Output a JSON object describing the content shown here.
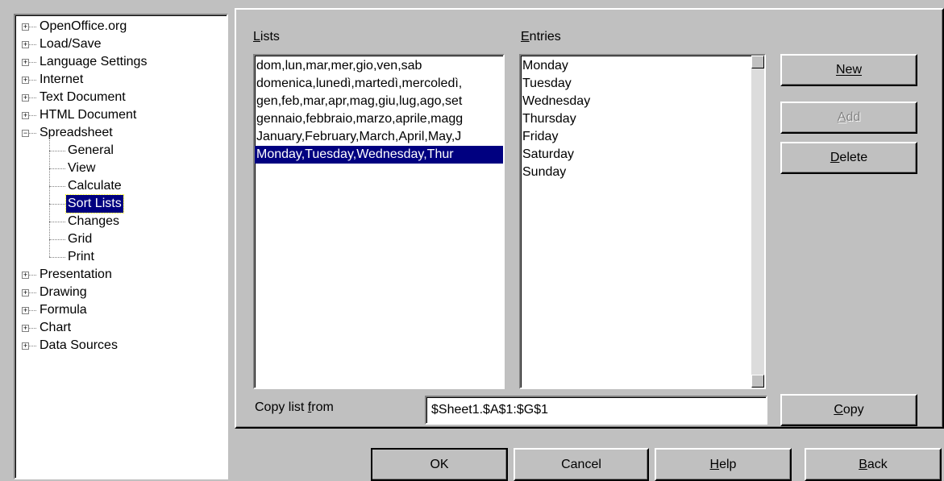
{
  "tree": {
    "items": [
      {
        "label": "OpenOffice.org",
        "level": 0,
        "expander": "+"
      },
      {
        "label": "Load/Save",
        "level": 0,
        "expander": "+"
      },
      {
        "label": "Language Settings",
        "level": 0,
        "expander": "+"
      },
      {
        "label": "Internet",
        "level": 0,
        "expander": "+"
      },
      {
        "label": "Text Document",
        "level": 0,
        "expander": "+"
      },
      {
        "label": "HTML Document",
        "level": 0,
        "expander": "+"
      },
      {
        "label": "Spreadsheet",
        "level": 0,
        "expander": "−"
      },
      {
        "label": "General",
        "level": 1
      },
      {
        "label": "View",
        "level": 1
      },
      {
        "label": "Calculate",
        "level": 1
      },
      {
        "label": "Sort Lists",
        "level": 1,
        "selected": true
      },
      {
        "label": "Changes",
        "level": 1
      },
      {
        "label": "Grid",
        "level": 1
      },
      {
        "label": "Print",
        "level": 1
      },
      {
        "label": "Presentation",
        "level": 0,
        "expander": "+"
      },
      {
        "label": "Drawing",
        "level": 0,
        "expander": "+"
      },
      {
        "label": "Formula",
        "level": 0,
        "expander": "+"
      },
      {
        "label": "Chart",
        "level": 0,
        "expander": "+"
      },
      {
        "label": "Data Sources",
        "level": 0,
        "expander": "+"
      }
    ]
  },
  "lists": {
    "label": "Lists",
    "items": [
      "dom,lun,mar,mer,gio,ven,sab",
      "domenica,lunedì,martedì,mercoledì,",
      "gen,feb,mar,apr,mag,giu,lug,ago,set",
      "gennaio,febbraio,marzo,aprile,magg",
      "January,February,March,April,May,J",
      "Monday,Tuesday,Wednesday,Thur"
    ],
    "selected_index": 5
  },
  "entries": {
    "label": "Entries",
    "items": [
      "Monday",
      "Tuesday",
      "Wednesday",
      "Thursday",
      "Friday",
      "Saturday",
      "Sunday"
    ]
  },
  "buttons": {
    "new": "New",
    "add": "Add",
    "delete": "Delete",
    "copy": "Copy"
  },
  "copy_from": {
    "label": "Copy list from",
    "value": "$Sheet1.$A$1:$G$1"
  },
  "footer": {
    "ok": "OK",
    "cancel": "Cancel",
    "help": "Help",
    "back": "Back"
  },
  "colors": {
    "face": "#c0c0c0",
    "selection": "#000080"
  }
}
